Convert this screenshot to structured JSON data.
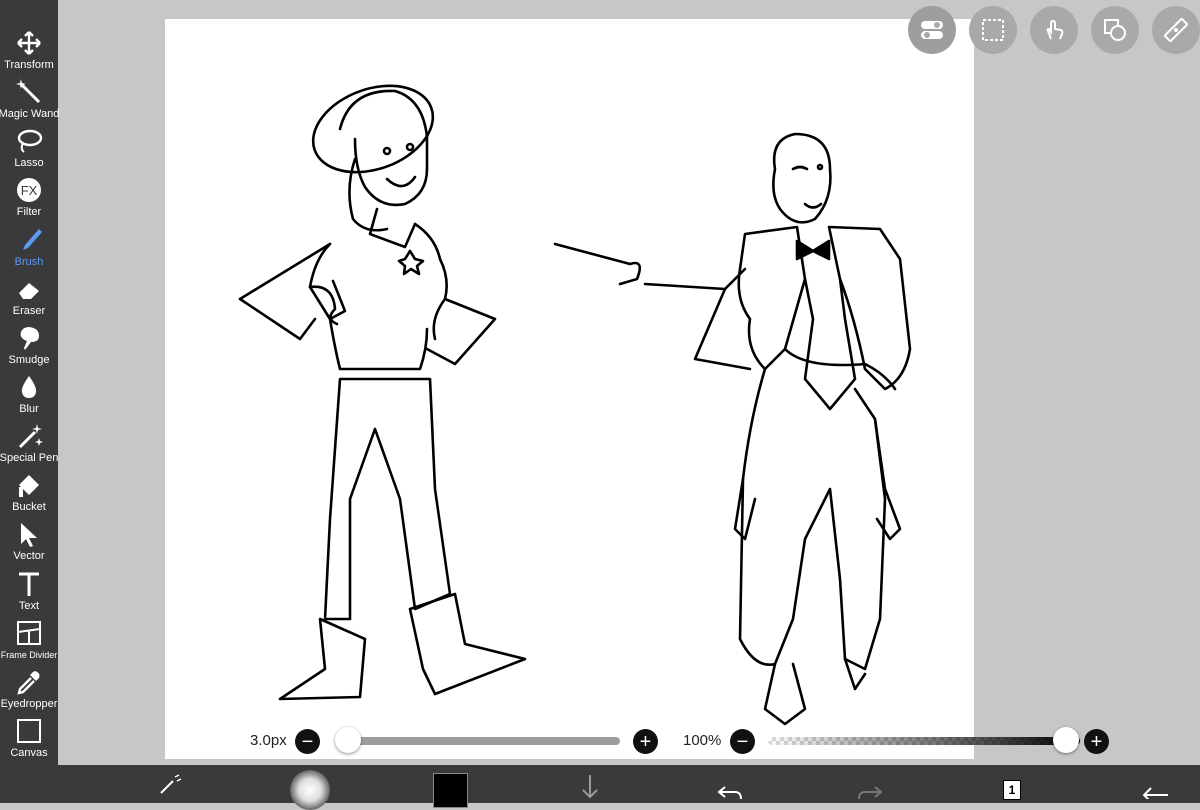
{
  "tools": [
    {
      "id": "transform",
      "label": "Transform",
      "icon": "move-arrows-icon",
      "active": false
    },
    {
      "id": "magic-wand",
      "label": "Magic Wand",
      "icon": "magic-wand-icon",
      "active": false
    },
    {
      "id": "lasso",
      "label": "Lasso",
      "icon": "lasso-icon",
      "active": false
    },
    {
      "id": "filter",
      "label": "Filter",
      "icon": "fx-icon",
      "active": false
    },
    {
      "id": "brush",
      "label": "Brush",
      "icon": "brush-icon",
      "active": true
    },
    {
      "id": "eraser",
      "label": "Eraser",
      "icon": "eraser-icon",
      "active": false
    },
    {
      "id": "smudge",
      "label": "Smudge",
      "icon": "smudge-icon",
      "active": false
    },
    {
      "id": "blur",
      "label": "Blur",
      "icon": "droplet-icon",
      "active": false
    },
    {
      "id": "special-pen",
      "label": "Special Pen",
      "icon": "sparkle-pen-icon",
      "active": false
    },
    {
      "id": "bucket",
      "label": "Bucket",
      "icon": "bucket-icon",
      "active": false
    },
    {
      "id": "vector",
      "label": "Vector",
      "icon": "cursor-arrow-icon",
      "active": false
    },
    {
      "id": "text",
      "label": "Text",
      "icon": "text-t-icon",
      "active": false
    },
    {
      "id": "frame-divider",
      "label": "Frame Divider",
      "icon": "frame-divider-icon",
      "active": false
    },
    {
      "id": "eyedropper",
      "label": "Eyedropper",
      "icon": "eyedropper-icon",
      "active": false
    },
    {
      "id": "canvas",
      "label": "Canvas",
      "icon": "canvas-icon",
      "active": false
    }
  ],
  "brush_size": {
    "label": "3.0px",
    "fraction": 0.0
  },
  "opacity": {
    "label": "100%",
    "fraction": 1.0
  },
  "layers": {
    "count": "1"
  },
  "colors": {
    "active_tool": "#5b9bf0",
    "toolbar_bg": "#3a3a3c",
    "workspace_bg": "#c7c7c7",
    "current_color": "#000000"
  },
  "top_buttons": [
    "toggle-switch-icon",
    "selection-rect-icon",
    "touch-gesture-icon",
    "shape-icon",
    "ruler-icon"
  ]
}
